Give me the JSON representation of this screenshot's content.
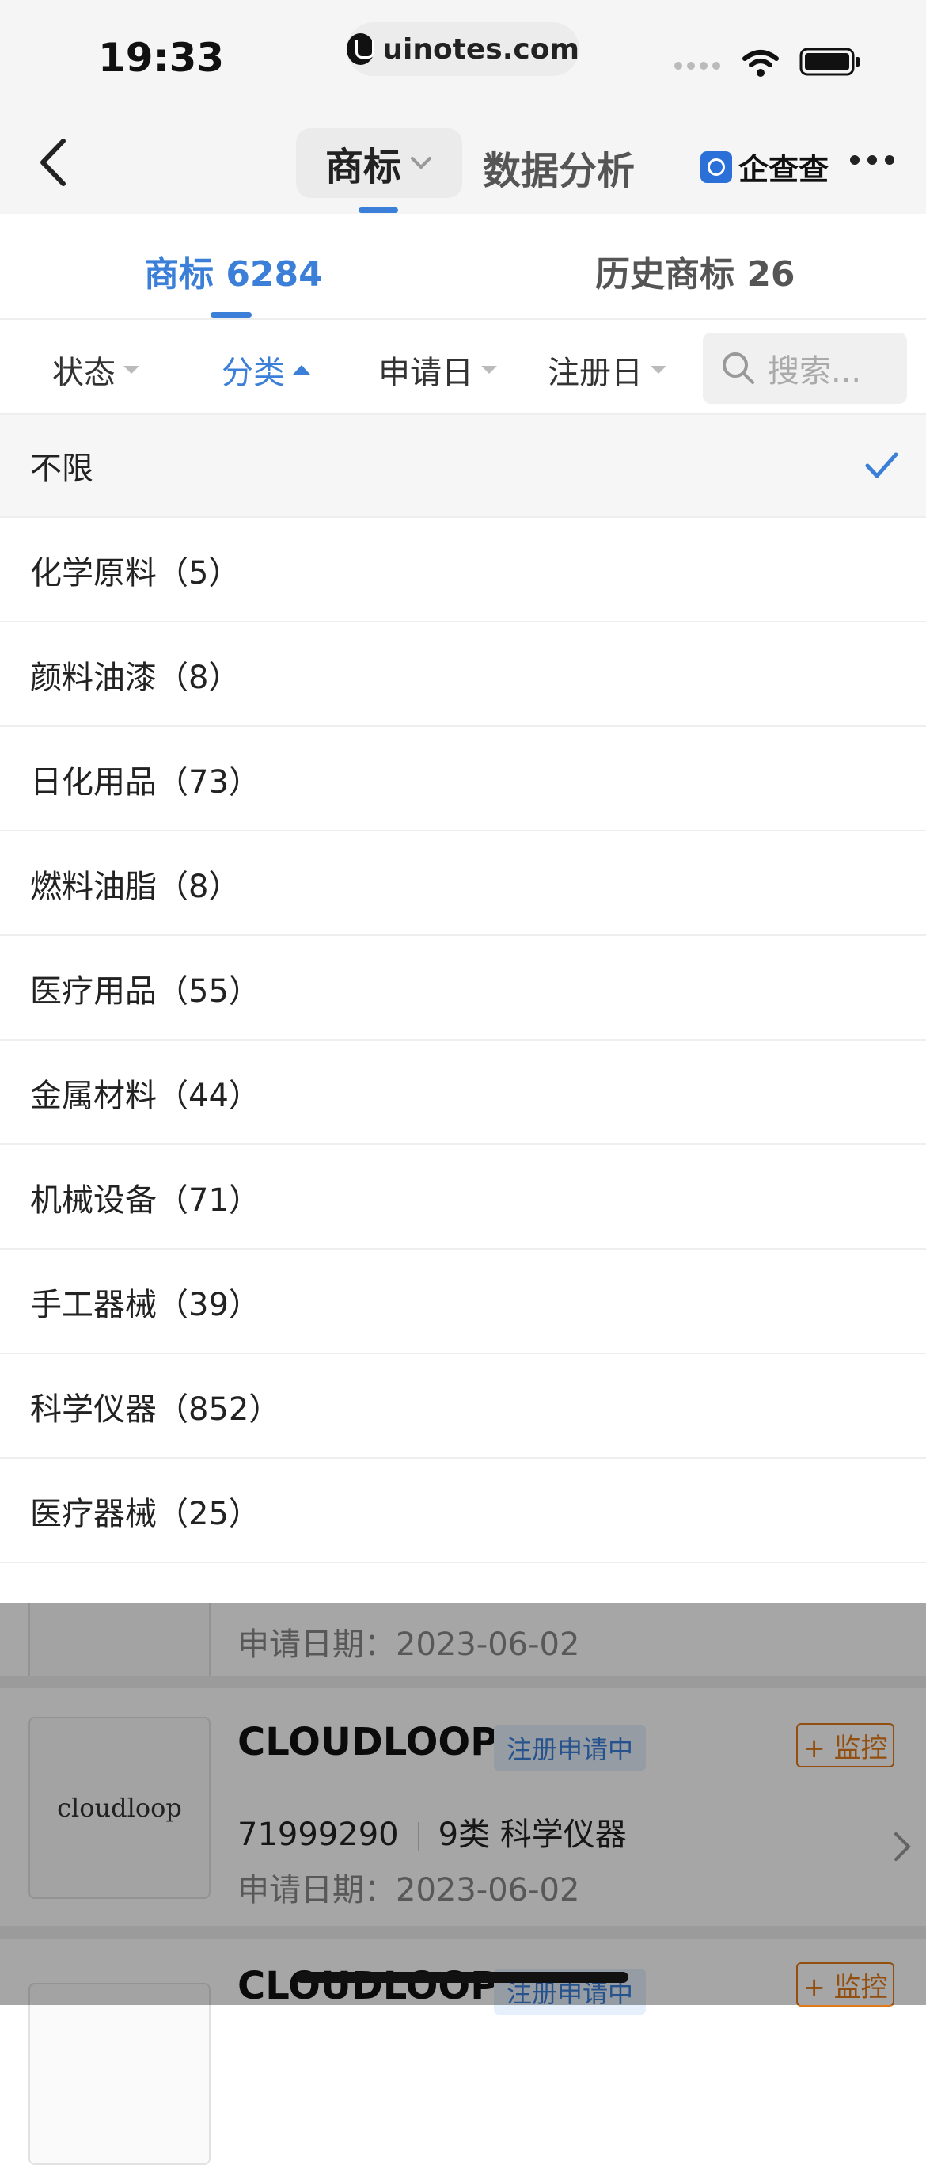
{
  "status_bar": {
    "time": "19:33",
    "url": "uinotes.com"
  },
  "nav": {
    "title_tab": "商标",
    "second_tab": "数据分析",
    "brand": "企查查"
  },
  "tabs": [
    {
      "label": "商标 6284",
      "active": true
    },
    {
      "label": "历史商标 26",
      "active": false
    }
  ],
  "filters": {
    "status": "状态",
    "category": "分类",
    "apply_date": "申请日",
    "register_date": "注册日",
    "search_placeholder": "搜索..."
  },
  "category_options": [
    {
      "label": "不限",
      "selected": true
    },
    {
      "label": "化学原料（5）"
    },
    {
      "label": "颜料油漆（8）"
    },
    {
      "label": "日化用品（73）"
    },
    {
      "label": "燃料油脂（8）"
    },
    {
      "label": "医疗用品（55）"
    },
    {
      "label": "金属材料（44）"
    },
    {
      "label": "机械设备（71）"
    },
    {
      "label": "手工器械（39）"
    },
    {
      "label": "科学仪器（852）"
    },
    {
      "label": "医疗器械（25）"
    }
  ],
  "list": [
    {
      "date": "申请日期：2023-06-02"
    },
    {
      "thumb_text": "cloudloop",
      "name": "CLOUDLOOP",
      "badge": "注册申请中",
      "monitor": "+ 监控",
      "reg_no": "71999290",
      "class": "9类 科学仪器",
      "date": "申请日期：2023-06-02"
    },
    {
      "name": "CLOUDLOOP",
      "badge": "注册申请中",
      "monitor": "+ 监控"
    }
  ],
  "colors": {
    "accent": "#3b7fd9",
    "monitor": "#e07a18"
  }
}
